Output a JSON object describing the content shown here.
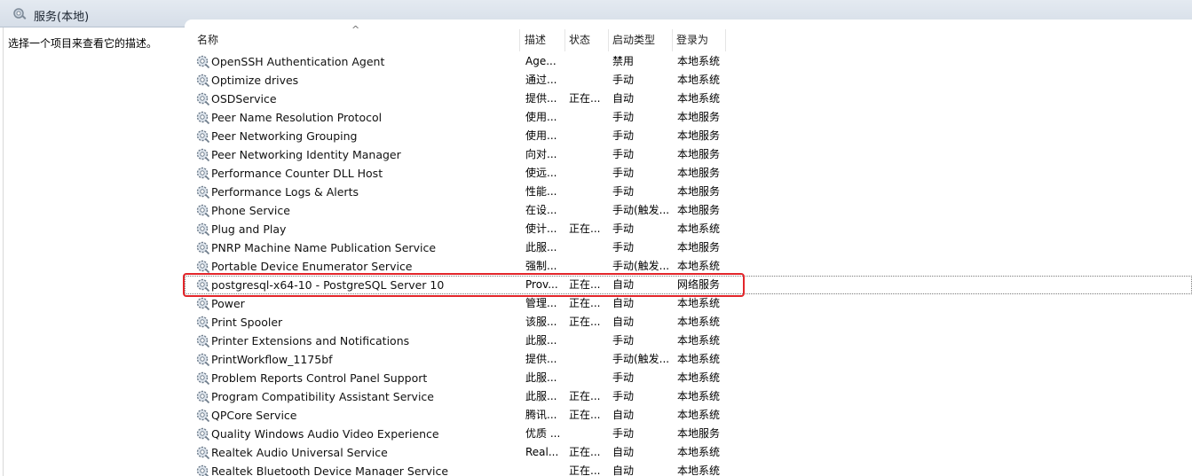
{
  "window": {
    "title": "服务(本地)",
    "icon": "services-icon"
  },
  "left_pane": {
    "description": "选择一个项目来查看它的描述。"
  },
  "columns": {
    "name": "名称",
    "description": "描述",
    "status": "状态",
    "startup_type": "启动类型",
    "log_on_as": "登录为",
    "sort_indicator": "^"
  },
  "services": [
    {
      "name": "OpenSSH Authentication Agent",
      "desc": "Age...",
      "status": "",
      "start": "禁用",
      "logon": "本地系统"
    },
    {
      "name": "Optimize drives",
      "desc": "通过...",
      "status": "",
      "start": "手动",
      "logon": "本地系统"
    },
    {
      "name": "OSDService",
      "desc": "提供...",
      "status": "正在...",
      "start": "自动",
      "logon": "本地系统"
    },
    {
      "name": "Peer Name Resolution Protocol",
      "desc": "使用...",
      "status": "",
      "start": "手动",
      "logon": "本地服务"
    },
    {
      "name": "Peer Networking Grouping",
      "desc": "使用...",
      "status": "",
      "start": "手动",
      "logon": "本地服务"
    },
    {
      "name": "Peer Networking Identity Manager",
      "desc": "向对...",
      "status": "",
      "start": "手动",
      "logon": "本地服务"
    },
    {
      "name": "Performance Counter DLL Host",
      "desc": "使远...",
      "status": "",
      "start": "手动",
      "logon": "本地服务"
    },
    {
      "name": "Performance Logs & Alerts",
      "desc": "性能...",
      "status": "",
      "start": "手动",
      "logon": "本地服务"
    },
    {
      "name": "Phone Service",
      "desc": "在设...",
      "status": "",
      "start": "手动(触发...",
      "logon": "本地服务"
    },
    {
      "name": "Plug and Play",
      "desc": "使计...",
      "status": "正在...",
      "start": "手动",
      "logon": "本地系统"
    },
    {
      "name": "PNRP Machine Name Publication Service",
      "desc": "此服...",
      "status": "",
      "start": "手动",
      "logon": "本地服务"
    },
    {
      "name": "Portable Device Enumerator Service",
      "desc": "强制...",
      "status": "",
      "start": "手动(触发...",
      "logon": "本地系统"
    },
    {
      "name": "postgresql-x64-10 - PostgreSQL Server 10",
      "desc": "Prov...",
      "status": "正在...",
      "start": "自动",
      "logon": "网络服务"
    },
    {
      "name": "Power",
      "desc": "管理...",
      "status": "正在...",
      "start": "自动",
      "logon": "本地系统"
    },
    {
      "name": "Print Spooler",
      "desc": "该服...",
      "status": "正在...",
      "start": "自动",
      "logon": "本地系统"
    },
    {
      "name": "Printer Extensions and Notifications",
      "desc": "此服...",
      "status": "",
      "start": "手动",
      "logon": "本地系统"
    },
    {
      "name": "PrintWorkflow_1175bf",
      "desc": "提供...",
      "status": "",
      "start": "手动(触发...",
      "logon": "本地系统"
    },
    {
      "name": "Problem Reports Control Panel Support",
      "desc": "此服...",
      "status": "",
      "start": "手动",
      "logon": "本地系统"
    },
    {
      "name": "Program Compatibility Assistant Service",
      "desc": "此服...",
      "status": "正在...",
      "start": "手动",
      "logon": "本地系统"
    },
    {
      "name": "QPCore Service",
      "desc": "腾讯...",
      "status": "正在...",
      "start": "自动",
      "logon": "本地系统"
    },
    {
      "name": "Quality Windows Audio Video Experience",
      "desc": "优质 ...",
      "status": "",
      "start": "手动",
      "logon": "本地服务"
    },
    {
      "name": "Realtek Audio Universal Service",
      "desc": "Real...",
      "status": "正在...",
      "start": "自动",
      "logon": "本地系统"
    },
    {
      "name": "Realtek Bluetooth Device Manager Service",
      "desc": "",
      "status": "正在...",
      "start": "自动",
      "logon": "本地系统"
    }
  ],
  "selected_service": "postgresql-x64-10 - PostgreSQL Server 10",
  "colors": {
    "highlight_border": "#e3262b",
    "titlebar": "#dbe3ec"
  }
}
